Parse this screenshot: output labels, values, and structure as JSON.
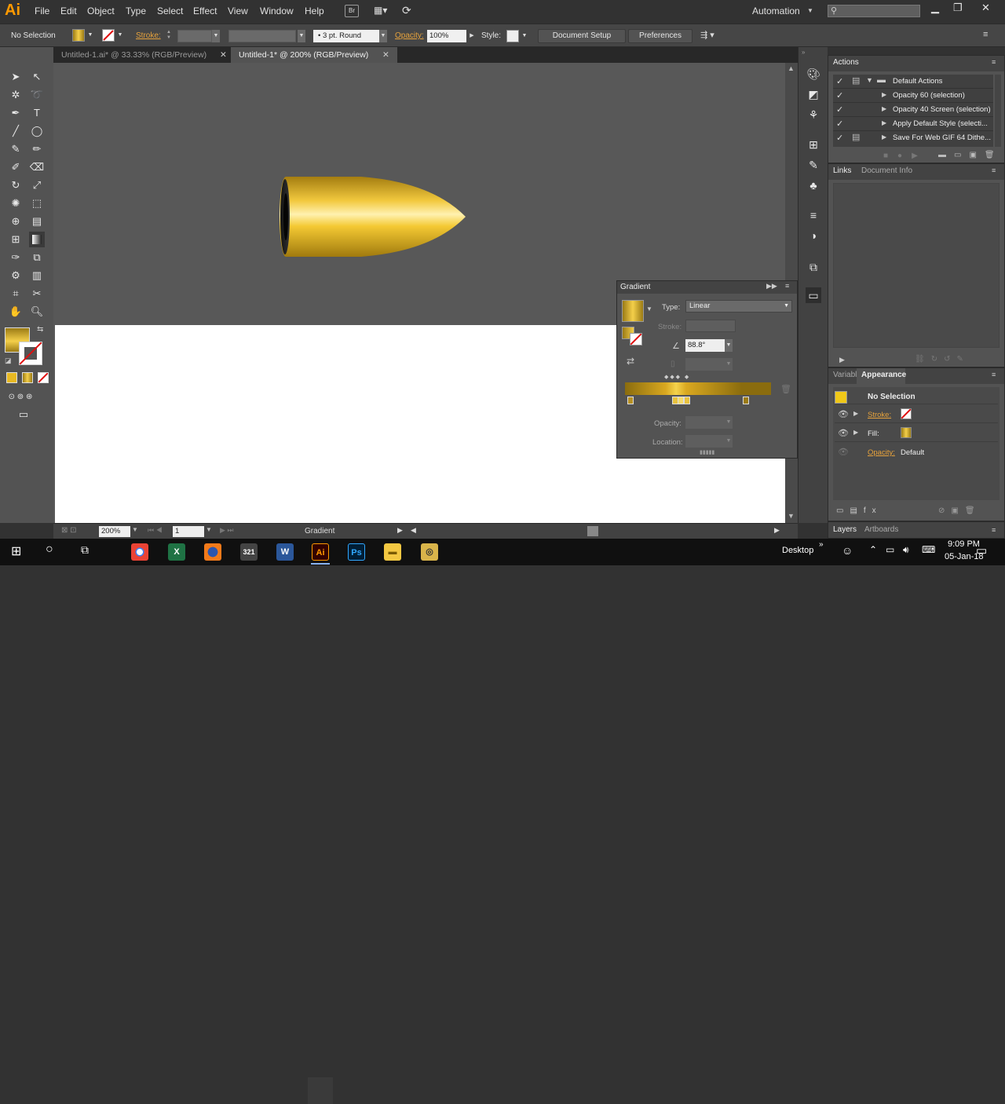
{
  "app": {
    "logo": "Ai"
  },
  "menu": [
    "File",
    "Edit",
    "Object",
    "Type",
    "Select",
    "Effect",
    "View",
    "Window",
    "Help"
  ],
  "menubar_right": {
    "workspace": "Automation",
    "search_placeholder": ""
  },
  "control": {
    "selection": "No Selection",
    "stroke_label": "Stroke:",
    "brush": "3 pt. Round",
    "opacity_label": "Opacity:",
    "opacity_value": "100%",
    "style_label": "Style:",
    "document_setup": "Document Setup",
    "preferences": "Preferences"
  },
  "tabs": [
    {
      "label": "Untitled-1.ai* @ 33.33% (RGB/Preview)",
      "active": false
    },
    {
      "label": "Untitled-1* @ 200% (RGB/Preview)",
      "active": true
    }
  ],
  "status": {
    "zoom": "200%",
    "page": "1",
    "tool": "Gradient"
  },
  "actions_panel": {
    "title": "Actions",
    "set": "Default Actions",
    "items": [
      "Opacity 60 (selection)",
      "Opacity 40 Screen (selection)",
      "Apply Default Style (selecti...",
      "Save For Web GIF 64 Dithe..."
    ]
  },
  "links_panel": {
    "tabs": [
      "Links",
      "Document Info"
    ]
  },
  "appearance_panel": {
    "tabs": [
      "Variables",
      "Appearance"
    ],
    "selection": "No Selection",
    "stroke_label": "Stroke:",
    "fill_label": "Fill:",
    "opacity_label": "Opacity:",
    "opacity_value": "Default"
  },
  "layers_panel": {
    "tabs": [
      "Layers",
      "Artboards"
    ]
  },
  "gradient_panel": {
    "title": "Gradient",
    "type_label": "Type:",
    "type_value": "Linear",
    "stroke_label": "Stroke:",
    "angle": "88.8°",
    "opacity_label": "Opacity:",
    "location_label": "Location:"
  },
  "taskbar": {
    "desktop": "Desktop",
    "time": "9:09 PM",
    "date": "05-Jan-18"
  },
  "colors": {
    "accent": "#ff9a00",
    "gold": "#e8b923",
    "panel": "#535353"
  }
}
